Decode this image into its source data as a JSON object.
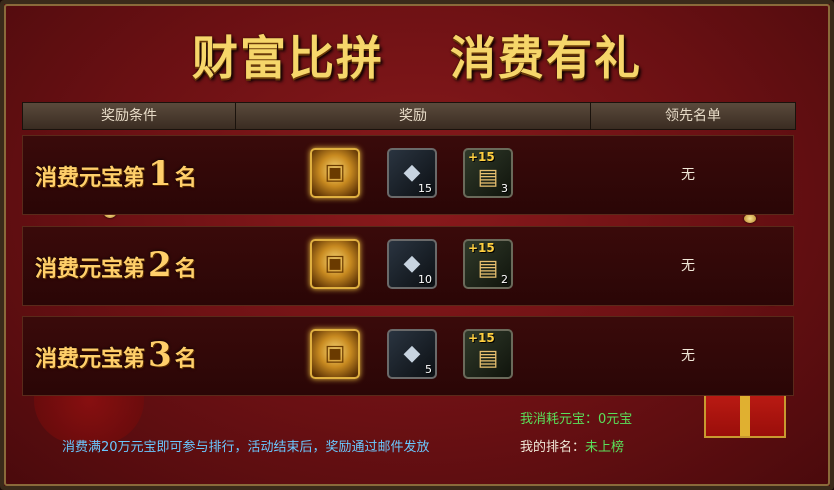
{
  "title": {
    "part1": "财富比拼",
    "part2": "消费有礼"
  },
  "table": {
    "headers": [
      "奖励条件",
      "奖励",
      "领先名单"
    ],
    "rows": [
      {
        "rank_prefix": "消费元宝第",
        "rank_num": "1",
        "rank_suffix": "名",
        "rewards": [
          {
            "icon": "treasure-chest-icon",
            "count": ""
          },
          {
            "icon": "silver-ingot-icon",
            "count": "15"
          },
          {
            "icon": "scroll-plus15-icon",
            "plus": "+15",
            "count": "3"
          }
        ],
        "leader": "无"
      },
      {
        "rank_prefix": "消费元宝第",
        "rank_num": "2",
        "rank_suffix": "名",
        "rewards": [
          {
            "icon": "treasure-chest-icon",
            "count": ""
          },
          {
            "icon": "silver-ingot-icon",
            "count": "10"
          },
          {
            "icon": "scroll-plus15-icon",
            "plus": "+15",
            "count": "2"
          }
        ],
        "leader": "无"
      },
      {
        "rank_prefix": "消费元宝第",
        "rank_num": "3",
        "rank_suffix": "名",
        "rewards": [
          {
            "icon": "treasure-chest-icon",
            "count": ""
          },
          {
            "icon": "silver-ingot-icon",
            "count": "5"
          },
          {
            "icon": "scroll-plus15-icon",
            "plus": "+15",
            "count": ""
          }
        ],
        "leader": "无"
      }
    ]
  },
  "footer": {
    "notice": "消费满20万元宝即可参与排行，活动结束后，奖励通过邮件发放",
    "my_spent_label": "我消耗元宝：",
    "my_spent_value": "0元宝",
    "my_rank_label": "我的排名：",
    "my_rank_value": "未上榜"
  },
  "colors": {
    "accent_gold": "#f6d66a",
    "notice_blue": "#6ac8ff",
    "value_green": "#5ae05a"
  }
}
